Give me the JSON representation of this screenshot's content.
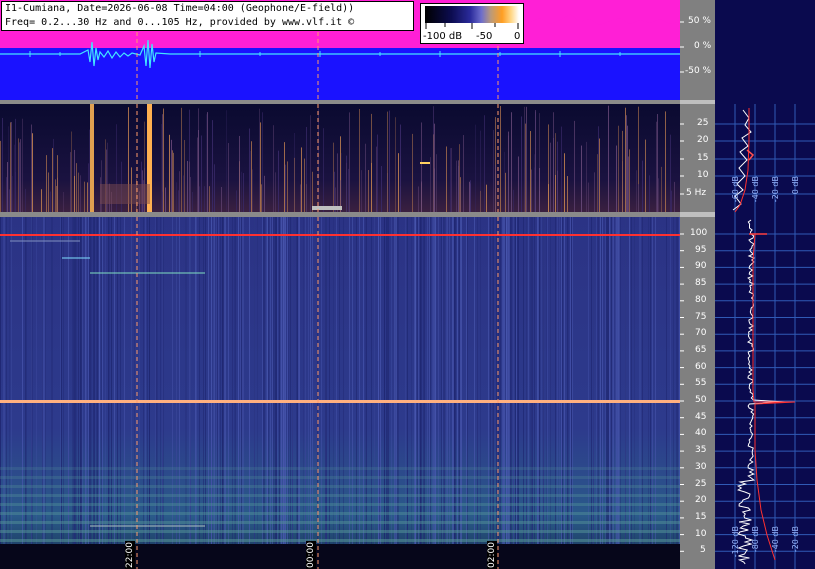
{
  "header": {
    "line1": "I1-Cumiana, Date=2026-06-08 Time=04:00 (Geophone/E-field))",
    "line2": "Freq= 0.2...30 Hz and 0...105 Hz, provided by www.vlf.it ©"
  },
  "colorbar": {
    "tick_min": "-100 dB",
    "tick_mid": "-50",
    "tick_max": "0"
  },
  "waveform_axis": {
    "pos50": "50 %",
    "zero": "0 %",
    "neg50": "-50 %"
  },
  "low_axis": [
    "25",
    "20",
    "15",
    "10",
    "5 Hz"
  ],
  "high_axis": [
    "100",
    "95",
    "90",
    "85",
    "80",
    "75",
    "70",
    "65",
    "60",
    "55",
    "50",
    "45",
    "40",
    "35",
    "30",
    "25",
    "20",
    "15",
    "10",
    "5"
  ],
  "time_markers": [
    "22:00",
    "00:00",
    "02:00"
  ],
  "spectrum_db_labels": {
    "low": [
      "-60 dB",
      "-40 dB",
      "-20 dB",
      "0 dB"
    ],
    "high": [
      "-120 dB",
      "-80 dB",
      "-40 dB",
      "-20 dB"
    ]
  },
  "colors": {
    "waveform_bg": "#1a12ff",
    "waveform_noise": "#ff1fd6",
    "trace": "#43e6ff",
    "spectrogram_bg": "#2b3385",
    "marker_line": "#ff9a6a",
    "spectrum_bg": "#0a0a4e"
  }
}
